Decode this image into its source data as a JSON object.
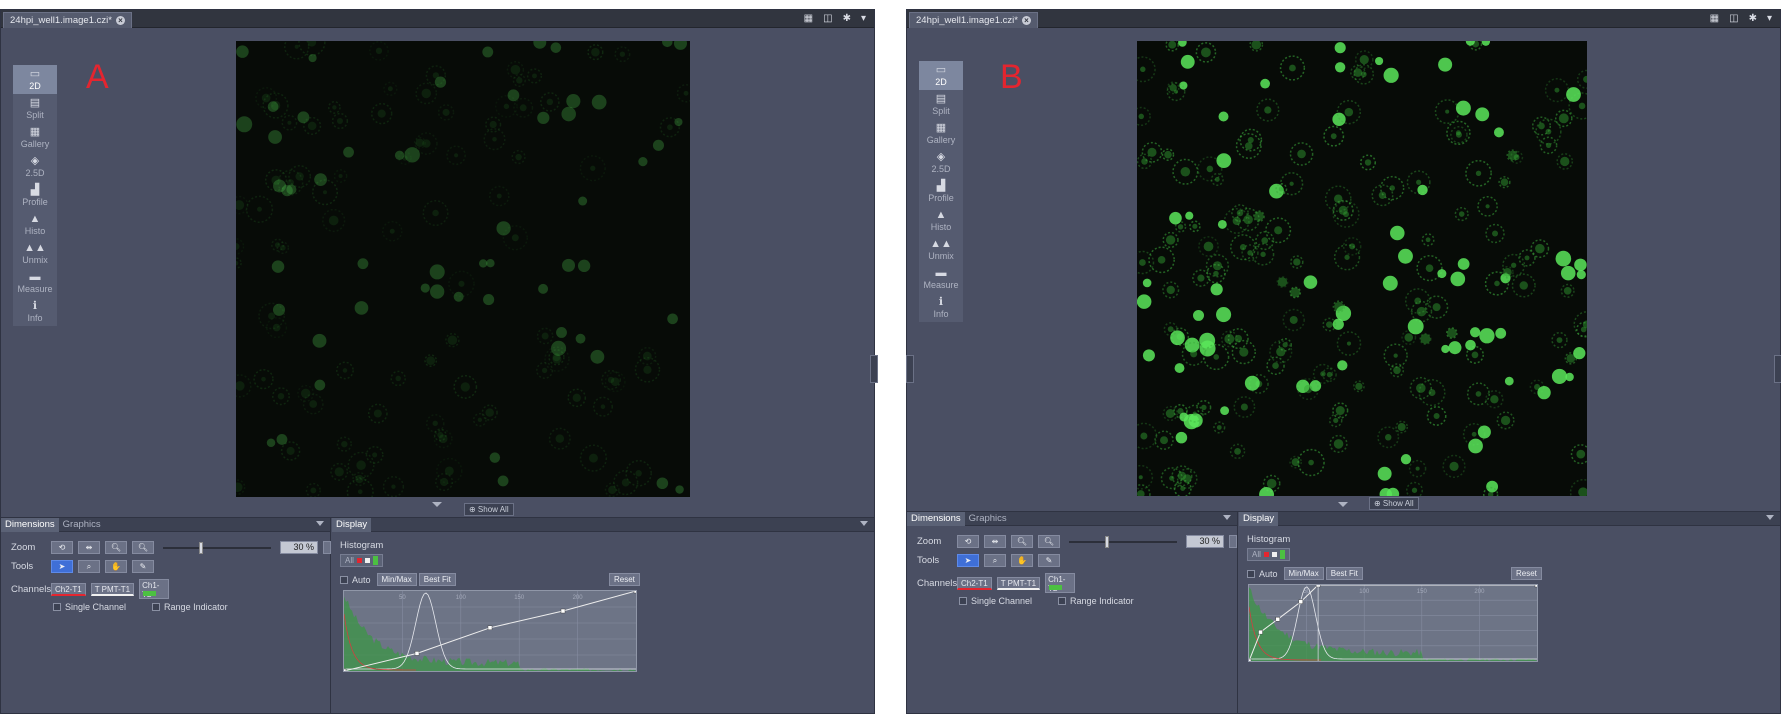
{
  "panels": {
    "a": {
      "letter": "A",
      "file_tab": "24hpi_well1.image1.czi*",
      "zoom_value": "30 %"
    },
    "b": {
      "letter": "B",
      "file_tab": "24hpi_well1.image1.czi*",
      "zoom_value": "30 %"
    }
  },
  "tab_tools": {
    "grid": "▦",
    "split": "◫",
    "settings": "✱",
    "menu": "▾"
  },
  "view_modes": [
    {
      "label": "2D",
      "icon": "square-icon"
    },
    {
      "label": "Split",
      "icon": "split-icon"
    },
    {
      "label": "Gallery",
      "icon": "grid-icon"
    },
    {
      "label": "2.5D",
      "icon": "perspective-icon"
    },
    {
      "label": "Profile",
      "icon": "profile-icon"
    },
    {
      "label": "Histo",
      "icon": "histogram-icon"
    },
    {
      "label": "Unmix",
      "icon": "unmix-icon"
    },
    {
      "label": "Measure",
      "icon": "ruler-icon"
    },
    {
      "label": "Info",
      "icon": "info-icon"
    }
  ],
  "view_mode_glyphs": [
    "▭",
    "▤",
    "▦",
    "◈",
    "▟",
    "▲",
    "▲▲",
    "▬",
    "ℹ"
  ],
  "show_all": "⊕ Show All",
  "bottom": {
    "tabs": {
      "dimensions": "Dimensions",
      "graphics": "Graphics",
      "display": "Display"
    },
    "zoom_label": "Zoom",
    "tools_label": "Tools",
    "channels_label": "Channels",
    "channels": [
      "Ch2-T1",
      "T PMT-T1",
      "Ch1-T2"
    ],
    "single_channel": "Single Channel",
    "range_indicator": "Range Indicator",
    "histogram_title": "Histogram",
    "histogram_all": "All",
    "auto": "Auto",
    "minmax": "Min/Max",
    "best_fit": "Best Fit",
    "reset": "Reset",
    "tick_labels": [
      "50",
      "100",
      "150",
      "200"
    ]
  },
  "colors": {
    "accent": "#3f6fd7",
    "red_channel": "#e4252f",
    "green_channel": "#4cc041"
  }
}
